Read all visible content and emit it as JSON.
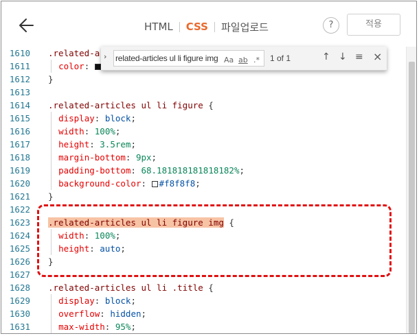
{
  "header": {
    "back_icon": "arrow-left-icon",
    "tabs": [
      {
        "label": "HTML",
        "active": false
      },
      {
        "label": "CSS",
        "active": true
      },
      {
        "label": "파일업로드",
        "active": false
      }
    ],
    "help_label": "?",
    "apply_label": "적용"
  },
  "find_widget": {
    "toggle_icon": "›",
    "query": "related-articles ul li figure img",
    "match_case": "Aa",
    "whole_word": "ab",
    "regex": ".*",
    "count": "1 of 1",
    "prev_icon": "↑",
    "next_icon": "↓",
    "selection_icon": "≡",
    "close_icon": "×"
  },
  "editor": {
    "line_numbers": [
      "1610",
      "1611",
      "1612",
      "1613",
      "1614",
      "1615",
      "1616",
      "1617",
      "1618",
      "1619",
      "1620",
      "1621",
      "1622",
      "1623",
      "1624",
      "1625",
      "1626",
      "1627",
      "1628",
      "1629",
      "1630",
      "1631"
    ],
    "blocks": {
      "b1_selector": ".related-a",
      "b1_color_prop": "color",
      "b1_close": "}",
      "b2_selector": ".related-articles ul li figure",
      "b2_open": " {",
      "b2_p1": "display",
      "b2_v1": "block",
      "b2_p2": "width",
      "b2_v2": "100%",
      "b2_p3": "height",
      "b2_v3": "3.5rem",
      "b2_p4": "margin-bottom",
      "b2_v4": "9px",
      "b2_p5": "padding-bottom",
      "b2_v5": "68.181818181818182%",
      "b2_p6": "background-color",
      "b2_v6": "#f8f8f8",
      "b2_close": "}",
      "b3_selector": ".related-articles ul li figure img",
      "b3_open": " {",
      "b3_p1": "width",
      "b3_v1": "100%",
      "b3_p2": "height",
      "b3_v2": "auto",
      "b3_close": "}",
      "b4_selector": ".related-articles ul li .title",
      "b4_open": " {",
      "b4_p1": "display",
      "b4_v1": "block",
      "b4_p2": "overflow",
      "b4_v2": "hidden",
      "b4_p3": "max-width",
      "b4_v3": "95%"
    }
  },
  "colors": {
    "active_tab": "#e9692c",
    "annotation": "#e01010",
    "search_highlight": "#f7c3a5"
  }
}
